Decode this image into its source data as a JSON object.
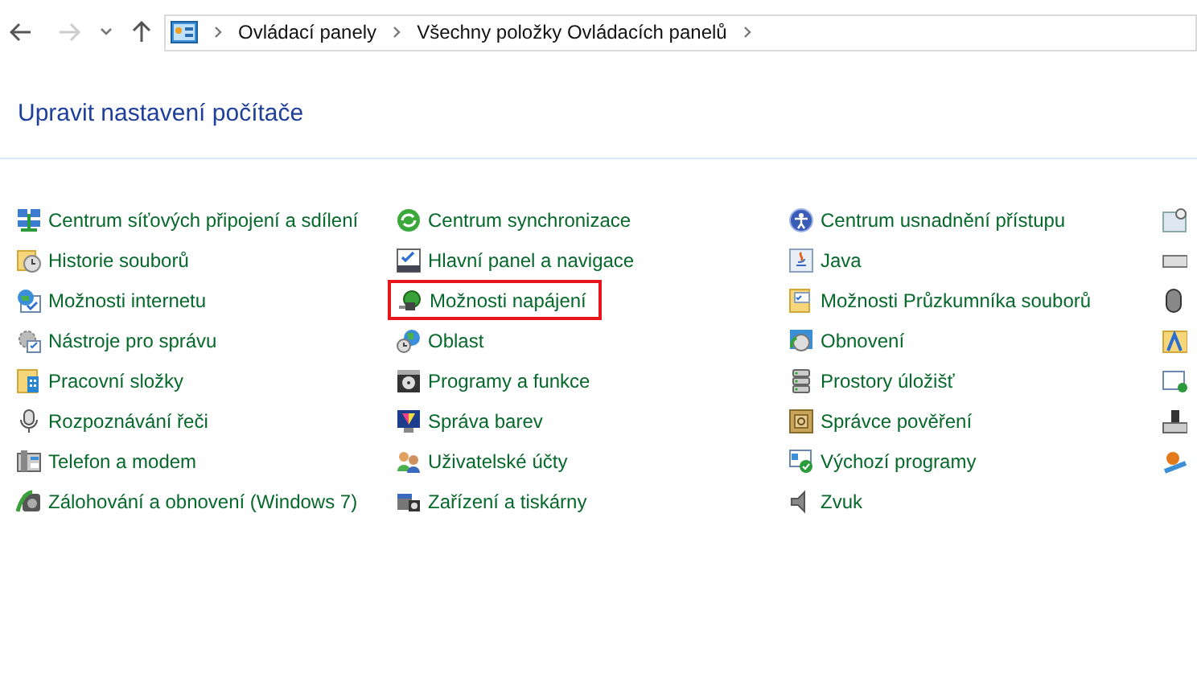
{
  "nav": {
    "back_disabled": false,
    "forward_disabled": true
  },
  "breadcrumb": [
    "Ovládací panely",
    "Všechny položky Ovládacích panelů"
  ],
  "heading": "Upravit nastavení počítače",
  "columns": [
    [
      {
        "label": "Centrum síťových připojení a sdílení",
        "highlighted": false
      },
      {
        "label": "Historie souborů",
        "highlighted": false
      },
      {
        "label": "Možnosti internetu",
        "highlighted": false
      },
      {
        "label": "Nástroje pro správu",
        "highlighted": false
      },
      {
        "label": "Pracovní složky",
        "highlighted": false
      },
      {
        "label": "Rozpoznávání řeči",
        "highlighted": false
      },
      {
        "label": "Telefon a modem",
        "highlighted": false
      },
      {
        "label": "Zálohování a obnovení (Windows 7)",
        "highlighted": false
      }
    ],
    [
      {
        "label": "Centrum synchronizace",
        "highlighted": false
      },
      {
        "label": "Hlavní panel a navigace",
        "highlighted": false
      },
      {
        "label": "Možnosti napájení",
        "highlighted": true
      },
      {
        "label": "Oblast",
        "highlighted": false
      },
      {
        "label": "Programy a funkce",
        "highlighted": false
      },
      {
        "label": "Správa barev",
        "highlighted": false
      },
      {
        "label": "Uživatelské účty",
        "highlighted": false
      },
      {
        "label": "Zařízení a tiskárny",
        "highlighted": false
      }
    ],
    [
      {
        "label": "Centrum usnadnění přístupu",
        "highlighted": false
      },
      {
        "label": "Java",
        "highlighted": false
      },
      {
        "label": "Možnosti Průzkumníka souborů",
        "highlighted": false
      },
      {
        "label": "Obnovení",
        "highlighted": false
      },
      {
        "label": "Prostory úložišť",
        "highlighted": false
      },
      {
        "label": "Správce pověření",
        "highlighted": false
      },
      {
        "label": "Výchozí programy",
        "highlighted": false
      },
      {
        "label": "Zvuk",
        "highlighted": false
      }
    ]
  ]
}
